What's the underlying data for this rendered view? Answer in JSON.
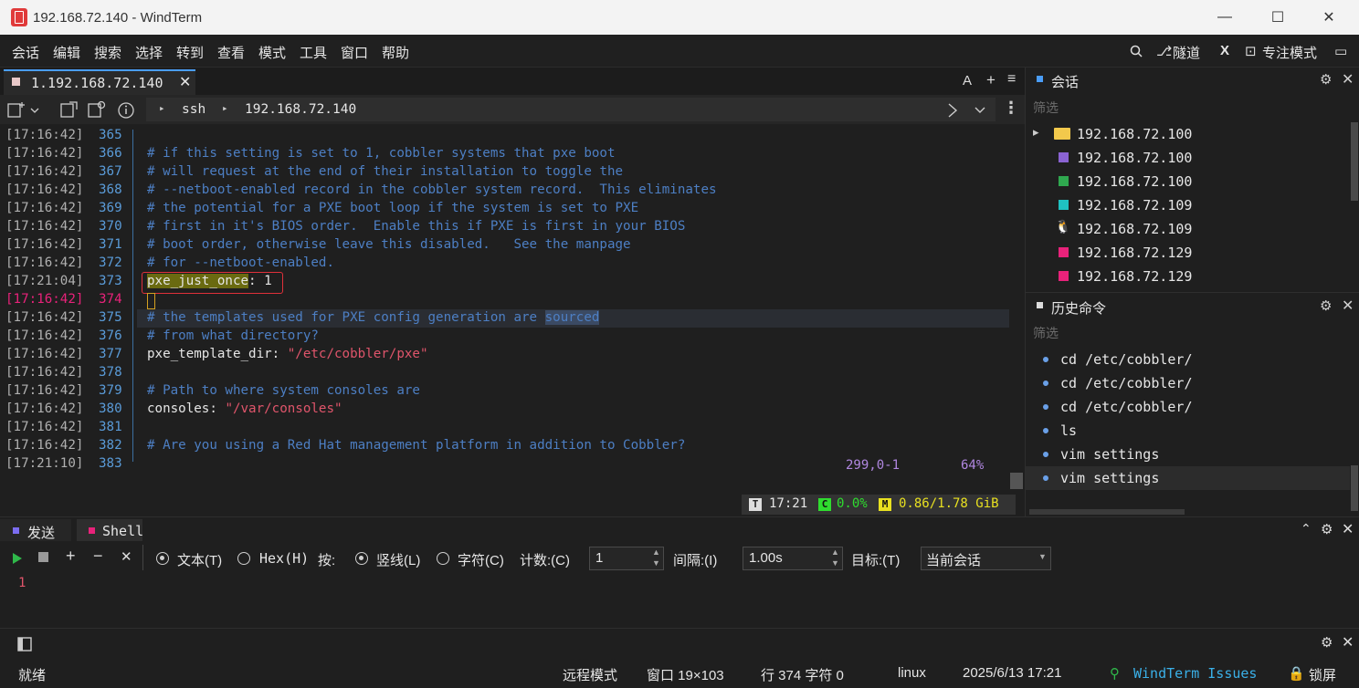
{
  "window": {
    "title": "192.168.72.140 - WindTerm",
    "minimize": "—",
    "maximize": "☐",
    "close": "✕"
  },
  "menu": [
    "会话",
    "编辑",
    "搜索",
    "选择",
    "转到",
    "查看",
    "模式",
    "工具",
    "窗口",
    "帮助"
  ],
  "toolbar_right": {
    "tunnel": "隧道",
    "x_label": "X",
    "focus_mode": "专注模式"
  },
  "tab": {
    "label": "1.192.168.72.140",
    "close": "✕",
    "font_btn": "A",
    "add_btn": "+",
    "menu_btn": "≡"
  },
  "address": {
    "protocol": "ssh",
    "host": "192.168.72.140"
  },
  "terminal": {
    "lines": [
      {
        "ts": "[17:16:42]",
        "ln": "365",
        "parts": []
      },
      {
        "ts": "[17:16:42]",
        "ln": "366",
        "parts": [
          {
            "c": "cmt",
            "t": "# if this setting is set to 1, cobbler systems that pxe boot"
          }
        ]
      },
      {
        "ts": "[17:16:42]",
        "ln": "367",
        "parts": [
          {
            "c": "cmt",
            "t": "# will request at the end of their installation to toggle the"
          }
        ]
      },
      {
        "ts": "[17:16:42]",
        "ln": "368",
        "parts": [
          {
            "c": "cmt",
            "t": "# --netboot-enabled record in the cobbler system record.  This eliminates"
          }
        ]
      },
      {
        "ts": "[17:16:42]",
        "ln": "369",
        "parts": [
          {
            "c": "cmt",
            "t": "# the potential for a PXE boot loop if the system is set to PXE"
          }
        ]
      },
      {
        "ts": "[17:16:42]",
        "ln": "370",
        "parts": [
          {
            "c": "cmt",
            "t": "# first in it's BIOS order.  Enable this if PXE is first in your BIOS"
          }
        ]
      },
      {
        "ts": "[17:16:42]",
        "ln": "371",
        "parts": [
          {
            "c": "cmt",
            "t": "# boot order, otherwise leave this disabled.   See the manpage"
          }
        ]
      },
      {
        "ts": "[17:16:42]",
        "ln": "372",
        "parts": [
          {
            "c": "cmt",
            "t": "# for --netboot-enabled."
          }
        ]
      },
      {
        "ts": "[17:21:04]",
        "ln": "373",
        "parts": [
          {
            "c": "key yellow-bg",
            "t": "pxe_just_once"
          },
          {
            "c": "key",
            "t": ": "
          },
          {
            "c": "num",
            "t": "1"
          }
        ]
      },
      {
        "ts": "[17:16:42]",
        "ln": "374",
        "parts": [],
        "current": true
      },
      {
        "ts": "[17:16:42]",
        "ln": "375",
        "parts": [
          {
            "c": "cmt",
            "t": "# the templates used for PXE config generation are "
          },
          {
            "c": "cmt sel-bg",
            "t": "sourced"
          }
        ]
      },
      {
        "ts": "[17:16:42]",
        "ln": "376",
        "parts": [
          {
            "c": "cmt",
            "t": "# from what directory?"
          }
        ]
      },
      {
        "ts": "[17:16:42]",
        "ln": "377",
        "parts": [
          {
            "c": "key",
            "t": "pxe_template_dir"
          },
          {
            "c": "key",
            "t": ": "
          },
          {
            "c": "str",
            "t": "\"/etc/cobbler/pxe\""
          }
        ]
      },
      {
        "ts": "[17:16:42]",
        "ln": "378",
        "parts": []
      },
      {
        "ts": "[17:16:42]",
        "ln": "379",
        "parts": [
          {
            "c": "cmt",
            "t": "# Path to where system consoles are"
          }
        ]
      },
      {
        "ts": "[17:16:42]",
        "ln": "380",
        "parts": [
          {
            "c": "key",
            "t": "consoles"
          },
          {
            "c": "key",
            "t": ": "
          },
          {
            "c": "str",
            "t": "\"/var/consoles\""
          }
        ]
      },
      {
        "ts": "[17:16:42]",
        "ln": "381",
        "parts": []
      },
      {
        "ts": "[17:16:42]",
        "ln": "382",
        "parts": [
          {
            "c": "cmt",
            "t": "# Are you using a Red Hat management platform in addition to Cobbler?"
          }
        ]
      },
      {
        "ts": "[17:21:10]",
        "ln": "383",
        "parts": []
      }
    ],
    "vim_position": "299,0-1",
    "vim_percent": "64%",
    "status": {
      "time": "17:21",
      "cpu": "0.0%",
      "mem": "0.86/1.78 GiB",
      "t_badge": "T",
      "c_badge": "C",
      "m_badge": "M"
    }
  },
  "sessions": {
    "title": "会话",
    "filter": "筛选",
    "items": [
      {
        "icon": "folder",
        "color": "#f2c94c",
        "label": "192.168.72.100"
      },
      {
        "icon": "square",
        "color": "#8a63d2",
        "label": "192.168.72.100"
      },
      {
        "icon": "square",
        "color": "#2fa84f",
        "label": "192.168.72.100"
      },
      {
        "icon": "square",
        "color": "#1fc2c2",
        "label": "192.168.72.109"
      },
      {
        "icon": "linux",
        "color": "#f0f0f0",
        "label": "192.168.72.109"
      },
      {
        "icon": "square",
        "color": "#e8227a",
        "label": "192.168.72.129"
      },
      {
        "icon": "square",
        "color": "#e8227a",
        "label": "192.168.72.129"
      }
    ]
  },
  "history": {
    "title": "历史命令",
    "filter": "筛选",
    "items": [
      "cd /etc/cobbler/",
      "cd /etc/cobbler/",
      "cd /etc/cobbler/",
      "ls",
      "vim settings",
      "vim settings"
    ]
  },
  "send": {
    "tabs": [
      "发送",
      "Shell"
    ],
    "text_mode": "文本(T)",
    "hex_mode": "Hex(H)",
    "by": "按:",
    "by_line": "竖线(L)",
    "by_char": "字符(C)",
    "count_label": "计数:(C)",
    "count_value": "1",
    "interval_label": "间隔:(I)",
    "interval_value": "1.00s",
    "target_label": "目标:(T)",
    "target_value": "当前会话",
    "content": "1"
  },
  "statusbar": {
    "ready": "就绪",
    "remote_mode": "远程模式",
    "window": "窗口 19×103",
    "position": "行 374 字符 0",
    "os": "linux",
    "datetime": "2025/6/13 17:21",
    "issues": "WindTerm Issues",
    "lock": "锁屏"
  },
  "colors": {
    "accent": "#4a9df8",
    "comment": "#4d7fc4",
    "string": "#e0556b",
    "line_number": "#5a9bd8"
  }
}
